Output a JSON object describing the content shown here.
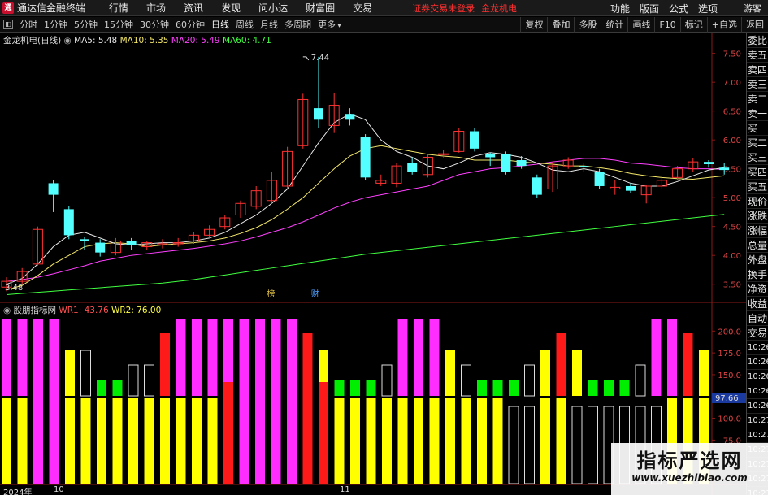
{
  "app": {
    "title": "通达信金融终端",
    "icon": "通"
  },
  "menu": [
    "行情",
    "市场",
    "资讯",
    "发现",
    "问小达",
    "财富圈",
    "交易"
  ],
  "notice": {
    "status": "证券交易未登录",
    "stock": "金龙机电"
  },
  "right_menu": [
    "功能",
    "版面",
    "公式",
    "选项"
  ],
  "guest": "游客",
  "toolbar": {
    "periods": [
      "分时",
      "1分钟",
      "5分钟",
      "15分钟",
      "30分钟",
      "60分钟",
      "日线",
      "周线",
      "月线",
      "多周期",
      "更多"
    ],
    "active": "日线",
    "buttons": [
      "复权",
      "叠加",
      "多股",
      "统计",
      "画线",
      "F10",
      "标记",
      "+自选",
      "返回"
    ]
  },
  "main_info": {
    "stock": "金龙机电(日线)",
    "ma5": "MA5: 5.48",
    "ma10": "MA10: 5.35",
    "ma20": "MA20: 5.49",
    "ma60": "MA60: 4.71"
  },
  "wr_info": {
    "name": "股朋指标网",
    "wr1": "WR1: 43.76",
    "wr2": "WR2: 76.00",
    "current": "97.66"
  },
  "side_panel": [
    "委比",
    "卖五",
    "卖四",
    "卖三",
    "卖二",
    "卖一",
    "买一",
    "买二",
    "买三",
    "买四",
    "买五",
    "现价",
    "涨跌",
    "涨幅",
    "总量",
    "外盘",
    "换手",
    "净资",
    "收益",
    "自动",
    "交易",
    "10:26",
    "10:26",
    "10:26",
    "10:26",
    "10:26",
    "10:27",
    "10:27",
    "10:27",
    "10:27",
    "10:27",
    "10:27"
  ],
  "dates": {
    "year": "2024年",
    "oct": "10",
    "nov": "11"
  },
  "markers": {
    "m1": "榜",
    "m2": "财"
  },
  "watermark": {
    "main": "指标严选网",
    "sub": "www.xuezhibiao.com"
  },
  "colors": {
    "up": "#ff3232",
    "down": "#54ffff",
    "ma5": "#e8e8e8",
    "ma10": "#f5e86a",
    "ma20": "#ff40ff",
    "ma60": "#40ff40",
    "magenta": "#ff2dff",
    "yellow": "#ffff00",
    "green": "#00ee00",
    "red": "#ff1a1a"
  },
  "chart_data": {
    "type": "candlestick",
    "y_ticks": [
      3.5,
      4.0,
      4.5,
      5.0,
      5.5,
      6.0,
      6.5,
      7.0,
      7.5
    ],
    "ylim": [
      3.2,
      7.65
    ],
    "high_label": "7.44",
    "low_label": "3.48",
    "candles": [
      [
        3.45,
        3.55,
        3.62,
        3.38
      ],
      [
        3.55,
        3.72,
        3.78,
        3.5
      ],
      [
        3.85,
        4.45,
        4.5,
        3.82
      ],
      [
        5.25,
        5.05,
        5.3,
        4.75
      ],
      [
        4.8,
        4.35,
        4.85,
        4.28
      ],
      [
        4.28,
        4.25,
        4.32,
        4.1
      ],
      [
        4.22,
        4.05,
        4.28,
        3.98
      ],
      [
        4.05,
        4.25,
        4.3,
        4.0
      ],
      [
        4.25,
        4.18,
        4.3,
        4.1
      ],
      [
        4.15,
        4.22,
        4.25,
        4.1
      ],
      [
        4.18,
        4.2,
        4.28,
        4.12
      ],
      [
        4.2,
        4.22,
        4.3,
        4.15
      ],
      [
        4.25,
        4.35,
        4.4,
        4.2
      ],
      [
        4.35,
        4.45,
        4.52,
        4.3
      ],
      [
        4.5,
        4.65,
        4.7,
        4.45
      ],
      [
        4.7,
        4.9,
        4.95,
        4.65
      ],
      [
        4.85,
        5.12,
        5.2,
        4.8
      ],
      [
        4.95,
        5.3,
        5.45,
        4.9
      ],
      [
        5.2,
        5.8,
        5.88,
        5.15
      ],
      [
        5.9,
        6.7,
        6.8,
        5.85
      ],
      [
        6.55,
        6.35,
        7.44,
        6.2
      ],
      [
        6.25,
        6.6,
        6.82,
        6.12
      ],
      [
        6.45,
        6.35,
        6.55,
        6.25
      ],
      [
        6.05,
        5.35,
        6.1,
        5.3
      ],
      [
        5.25,
        5.3,
        5.4,
        5.2
      ],
      [
        5.25,
        5.55,
        5.6,
        5.18
      ],
      [
        5.6,
        5.45,
        5.7,
        5.4
      ],
      [
        5.4,
        5.7,
        5.75,
        5.35
      ],
      [
        5.75,
        5.76,
        5.82,
        5.7
      ],
      [
        5.8,
        6.15,
        6.2,
        5.78
      ],
      [
        6.15,
        5.85,
        6.2,
        5.8
      ],
      [
        5.75,
        5.7,
        5.78,
        5.55
      ],
      [
        5.75,
        5.45,
        5.8,
        5.4
      ],
      [
        5.65,
        5.55,
        5.72,
        5.5
      ],
      [
        5.35,
        5.05,
        5.4,
        5.0
      ],
      [
        5.15,
        5.55,
        5.62,
        5.1
      ],
      [
        5.55,
        5.65,
        5.7,
        5.5
      ],
      [
        5.55,
        5.53,
        5.6,
        5.45
      ],
      [
        5.45,
        5.2,
        5.5,
        5.15
      ],
      [
        5.15,
        5.18,
        5.3,
        5.05
      ],
      [
        5.2,
        5.12,
        5.25,
        5.08
      ],
      [
        5.05,
        5.2,
        5.22,
        4.9
      ],
      [
        5.2,
        5.3,
        5.35,
        5.15
      ],
      [
        5.35,
        5.5,
        5.55,
        5.3
      ],
      [
        5.5,
        5.62,
        5.68,
        5.45
      ],
      [
        5.62,
        5.58,
        5.65,
        5.52
      ],
      [
        5.52,
        5.48,
        5.6,
        5.4
      ]
    ],
    "ma5": [
      3.5,
      3.6,
      3.85,
      4.15,
      4.35,
      4.4,
      4.3,
      4.2,
      4.18,
      4.2,
      4.22,
      4.22,
      4.25,
      4.3,
      4.4,
      4.55,
      4.7,
      4.9,
      5.15,
      5.55,
      5.95,
      6.3,
      6.45,
      6.35,
      6.0,
      5.8,
      5.7,
      5.55,
      5.5,
      5.6,
      5.72,
      5.78,
      5.75,
      5.7,
      5.6,
      5.48,
      5.45,
      5.5,
      5.45,
      5.35,
      5.25,
      5.2,
      5.2,
      5.28,
      5.38,
      5.48,
      5.52
    ],
    "ma10": [
      3.4,
      3.48,
      3.65,
      3.85,
      4.0,
      4.15,
      4.2,
      4.22,
      4.2,
      4.15,
      4.18,
      4.2,
      4.22,
      4.25,
      4.3,
      4.38,
      4.48,
      4.62,
      4.8,
      5.0,
      5.25,
      5.5,
      5.72,
      5.85,
      5.9,
      5.85,
      5.8,
      5.75,
      5.72,
      5.7,
      5.65,
      5.65,
      5.65,
      5.62,
      5.6,
      5.58,
      5.55,
      5.55,
      5.52,
      5.48,
      5.42,
      5.38,
      5.35,
      5.33,
      5.32,
      5.35,
      5.38
    ],
    "ma20": [
      3.55,
      3.58,
      3.62,
      3.68,
      3.75,
      3.82,
      3.9,
      3.95,
      4.0,
      4.03,
      4.06,
      4.09,
      4.12,
      4.16,
      4.2,
      4.25,
      4.32,
      4.4,
      4.48,
      4.58,
      4.7,
      4.82,
      4.92,
      5.0,
      5.05,
      5.1,
      5.15,
      5.2,
      5.3,
      5.4,
      5.45,
      5.5,
      5.52,
      5.55,
      5.58,
      5.62,
      5.65,
      5.68,
      5.68,
      5.65,
      5.6,
      5.58,
      5.55,
      5.52,
      5.5,
      5.5,
      5.49
    ],
    "ma60": [
      3.32,
      3.34,
      3.36,
      3.38,
      3.4,
      3.42,
      3.44,
      3.46,
      3.48,
      3.5,
      3.52,
      3.55,
      3.58,
      3.62,
      3.66,
      3.7,
      3.74,
      3.78,
      3.82,
      3.86,
      3.9,
      3.94,
      3.98,
      4.02,
      4.05,
      4.08,
      4.11,
      4.14,
      4.17,
      4.2,
      4.23,
      4.26,
      4.29,
      4.32,
      4.35,
      4.38,
      4.41,
      4.44,
      4.47,
      4.5,
      4.53,
      4.56,
      4.59,
      4.62,
      4.65,
      4.68,
      4.71
    ],
    "wr_y_ticks": [
      75.0,
      100.0,
      125.0,
      150.0,
      175.0,
      200.0
    ],
    "wr_ylim": [
      25,
      218
    ],
    "wr_top": [
      {
        "v": 0,
        "c": "magenta"
      },
      {
        "v": 0,
        "c": "magenta"
      },
      {
        "v": 0,
        "c": "magenta"
      },
      {
        "v": 0,
        "c": "magenta"
      },
      {
        "v": 150,
        "c": "yellow"
      },
      {
        "v": 150,
        "c": "outline"
      },
      {
        "v": 25,
        "c": "green"
      },
      {
        "v": 25,
        "c": "green"
      },
      {
        "v": 100,
        "c": "outline"
      },
      {
        "v": 100,
        "c": "outline"
      },
      {
        "v": 175,
        "c": "red"
      },
      {
        "v": 0,
        "c": "magenta"
      },
      {
        "v": 0,
        "c": "magenta"
      },
      {
        "v": 0,
        "c": "magenta"
      },
      {
        "v": 0,
        "c": "magenta"
      },
      {
        "v": 0,
        "c": "magenta"
      },
      {
        "v": 0,
        "c": "magenta"
      },
      {
        "v": 0,
        "c": "magenta"
      },
      {
        "v": 0,
        "c": "magenta"
      },
      {
        "v": 175,
        "c": "red"
      },
      {
        "v": 150,
        "c": "yellow"
      },
      {
        "v": 25,
        "c": "green"
      },
      {
        "v": 25,
        "c": "green"
      },
      {
        "v": 25,
        "c": "green"
      },
      {
        "v": 100,
        "c": "outline"
      },
      {
        "v": 0,
        "c": "magenta"
      },
      {
        "v": 0,
        "c": "magenta"
      },
      {
        "v": 0,
        "c": "magenta"
      },
      {
        "v": 150,
        "c": "yellow"
      },
      {
        "v": 100,
        "c": "outline"
      },
      {
        "v": 25,
        "c": "green"
      },
      {
        "v": 25,
        "c": "green"
      },
      {
        "v": 25,
        "c": "green"
      },
      {
        "v": 100,
        "c": "outline"
      },
      {
        "v": 150,
        "c": "yellow"
      },
      {
        "v": 175,
        "c": "red"
      },
      {
        "v": 150,
        "c": "yellow"
      },
      {
        "v": 25,
        "c": "green"
      },
      {
        "v": 25,
        "c": "green"
      },
      {
        "v": 25,
        "c": "green"
      },
      {
        "v": 100,
        "c": "outline"
      },
      {
        "v": 0,
        "c": "magenta"
      },
      {
        "v": 0,
        "c": "magenta"
      },
      {
        "v": 175,
        "c": "red"
      },
      {
        "v": 150,
        "c": "yellow"
      }
    ],
    "wr_bottom": [
      {
        "v": 0,
        "c": "yellow"
      },
      {
        "v": 0,
        "c": "yellow"
      },
      {
        "v": 0,
        "c": "magenta"
      },
      {
        "v": 0,
        "c": "magenta"
      },
      {
        "v": 0,
        "c": "yellow"
      },
      {
        "v": 0,
        "c": "yellow"
      },
      {
        "v": 0,
        "c": "yellow"
      },
      {
        "v": 0,
        "c": "yellow"
      },
      {
        "v": 0,
        "c": "yellow"
      },
      {
        "v": 0,
        "c": "yellow"
      },
      {
        "v": 0,
        "c": "yellow"
      },
      {
        "v": 0,
        "c": "yellow"
      },
      {
        "v": 0,
        "c": "yellow"
      },
      {
        "v": 0,
        "c": "yellow"
      },
      {
        "v": 0,
        "c": "red"
      },
      {
        "v": 0,
        "c": "magenta"
      },
      {
        "v": 0,
        "c": "magenta"
      },
      {
        "v": 0,
        "c": "magenta"
      },
      {
        "v": 0,
        "c": "magenta"
      },
      {
        "v": 0,
        "c": "red"
      },
      {
        "v": 0,
        "c": "red"
      },
      {
        "v": 0,
        "c": "yellow"
      },
      {
        "v": 0,
        "c": "yellow"
      },
      {
        "v": 0,
        "c": "yellow"
      },
      {
        "v": 0,
        "c": "yellow"
      },
      {
        "v": 0,
        "c": "yellow"
      },
      {
        "v": 0,
        "c": "yellow"
      },
      {
        "v": 0,
        "c": "yellow"
      },
      {
        "v": 0,
        "c": "yellow"
      },
      {
        "v": 0,
        "c": "yellow"
      },
      {
        "v": 0,
        "c": "yellow"
      },
      {
        "v": 0,
        "c": "yellow"
      },
      {
        "v": 0,
        "c": "outline"
      },
      {
        "v": 0,
        "c": "outline"
      },
      {
        "v": 0,
        "c": "yellow"
      },
      {
        "v": 0,
        "c": "yellow"
      },
      {
        "v": 0,
        "c": "outline"
      },
      {
        "v": 0,
        "c": "outline"
      },
      {
        "v": 0,
        "c": "outline"
      },
      {
        "v": 0,
        "c": "outline"
      },
      {
        "v": 0,
        "c": "outline"
      },
      {
        "v": 0,
        "c": "outline"
      },
      {
        "v": 0,
        "c": "yellow"
      },
      {
        "v": 0,
        "c": "yellow"
      },
      {
        "v": 0,
        "c": "yellow"
      }
    ],
    "wr_bottom_top": [
      490,
      490,
      460,
      460,
      490,
      490,
      490,
      490,
      490,
      490,
      490,
      490,
      490,
      490,
      470,
      450,
      450,
      450,
      450,
      470,
      470,
      490,
      490,
      490,
      490,
      490,
      490,
      490,
      490,
      490,
      490,
      490,
      500,
      500,
      490,
      490,
      500,
      500,
      500,
      500,
      500,
      500,
      490,
      490,
      490
    ]
  }
}
